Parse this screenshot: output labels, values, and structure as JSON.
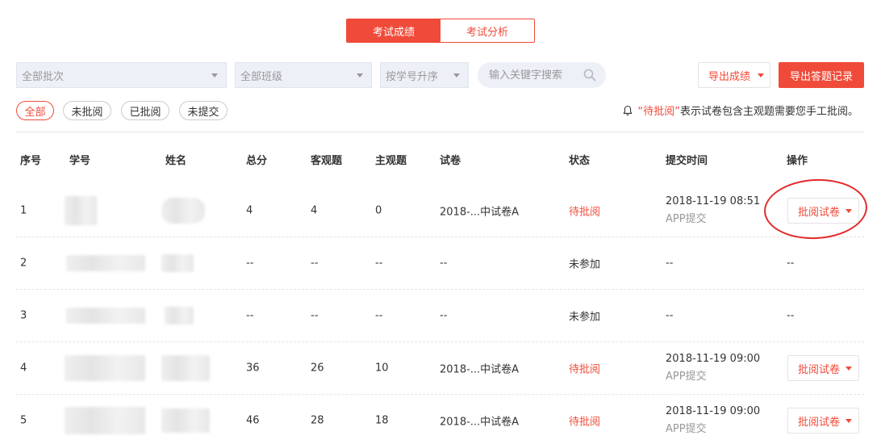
{
  "tabs": [
    {
      "label": "考试成绩",
      "active": true
    },
    {
      "label": "考试分析",
      "active": false
    }
  ],
  "filters_bar": {
    "batch_select": "全部批次",
    "class_select": "全部班级",
    "sort_select": "按学号升序",
    "search_placeholder": "输入关键字搜索",
    "export_score_label": "导出成绩",
    "export_answers_label": "导出答题记录"
  },
  "status_filters": [
    {
      "label": "全部",
      "active": true
    },
    {
      "label": "未批阅",
      "active": false
    },
    {
      "label": "已批阅",
      "active": false
    },
    {
      "label": "未提交",
      "active": false
    }
  ],
  "notice": {
    "highlight": "“待批阅”",
    "text": "表示试卷包含主观题需要您手工批阅。"
  },
  "table": {
    "headers": [
      "序号",
      "学号",
      "姓名",
      "总分",
      "客观题",
      "主观题",
      "试卷",
      "状态",
      "提交时间",
      "操作"
    ],
    "rows": [
      {
        "index": "1",
        "total": "4",
        "objective": "4",
        "subjective": "0",
        "paper": "2018-...中试卷A",
        "status": "待批阅",
        "submit_time": "2018-11-19 08:51",
        "submit_via": "APP提交",
        "action": "批阅试卷"
      },
      {
        "index": "2",
        "total": "--",
        "objective": "--",
        "subjective": "--",
        "paper": "--",
        "status": "未参加",
        "submit_time": "--",
        "submit_via": "",
        "action": "--"
      },
      {
        "index": "3",
        "total": "--",
        "objective": "--",
        "subjective": "--",
        "paper": "--",
        "status": "未参加",
        "submit_time": "--",
        "submit_via": "",
        "action": "--"
      },
      {
        "index": "4",
        "total": "36",
        "objective": "26",
        "subjective": "10",
        "paper": "2018-...中试卷A",
        "status": "待批阅",
        "submit_time": "2018-11-19 09:00",
        "submit_via": "APP提交",
        "action": "批阅试卷"
      },
      {
        "index": "5",
        "total": "46",
        "objective": "28",
        "subjective": "18",
        "paper": "2018-...中试卷A",
        "status": "待批阅",
        "submit_time": "2018-11-19 09:00",
        "submit_via": "APP提交",
        "action": "批阅试卷"
      }
    ]
  },
  "colors": {
    "accent": "#f04b3a",
    "annotation": "#e32b2b"
  }
}
